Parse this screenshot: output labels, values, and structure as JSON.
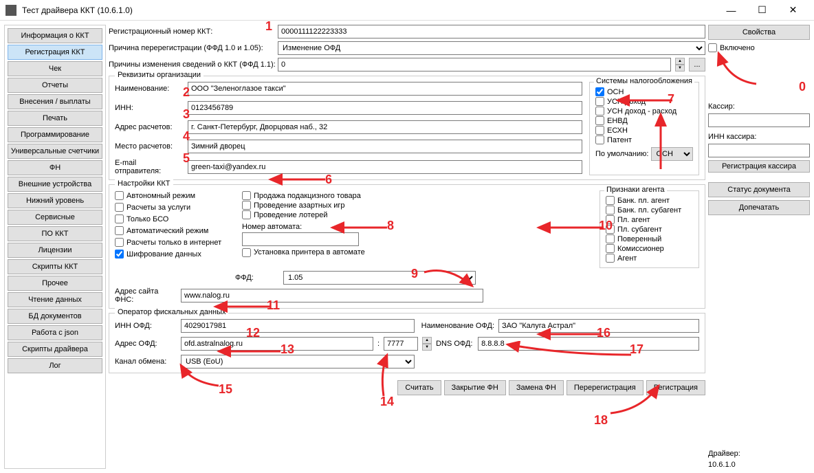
{
  "titlebar": {
    "title": "Тест драйвера ККТ (10.6.1.0)"
  },
  "sidebar_left": [
    "Информация о ККТ",
    "Регистрация ККТ",
    "Чек",
    "Отчеты",
    "Внесения / выплаты",
    "Печать",
    "Программирование",
    "Универсальные счетчики",
    "ФН",
    "Внешние устройства",
    "Нижний уровень",
    "Сервисные",
    "ПО ККТ",
    "Лицензии",
    "Скрипты ККТ",
    "Прочее",
    "Чтение данных",
    "БД документов",
    "Работа с json",
    "Скрипты драйвера",
    "Лог"
  ],
  "sidebar_active_index": 1,
  "top": {
    "reg_num_label": "Регистрационный номер ККТ:",
    "reg_num_value": "0000111122223333",
    "rereg_reason_label": "Причина перерегистрации (ФФД 1.0 и 1.05):",
    "rereg_reason_value": "Изменение ОФД",
    "change_reasons_label": "Причины изменения сведений о ККТ (ФФД 1.1):",
    "change_reasons_value": "0"
  },
  "org": {
    "legend": "Реквизиты организации",
    "name_label": "Наименование:",
    "name_value": "ООО \"Зеленоглазое такси\"",
    "inn_label": "ИНН:",
    "inn_value": "0123456789",
    "addr_label": "Адрес расчетов:",
    "addr_value": "г. Санкт-Петербург, Дворцовая наб., 32",
    "place_label": "Место расчетов:",
    "place_value": "Зимний дворец",
    "email_label": "E-mail отправителя:",
    "email_value": "green-taxi@yandex.ru"
  },
  "tax": {
    "legend": "Системы налогообложения",
    "items": [
      {
        "label": "ОСН",
        "checked": true
      },
      {
        "label": "УСН доход",
        "checked": false
      },
      {
        "label": "УСН доход - расход",
        "checked": false
      },
      {
        "label": "ЕНВД",
        "checked": false
      },
      {
        "label": "ЕСХН",
        "checked": false
      },
      {
        "label": "Патент",
        "checked": false
      }
    ],
    "default_label": "По умолчанию:",
    "default_value": "ОСН"
  },
  "kkt": {
    "legend": "Настройки ККТ",
    "col1": [
      {
        "label": "Автономный режим",
        "checked": false
      },
      {
        "label": "Расчеты за услуги",
        "checked": false
      },
      {
        "label": "Только БСО",
        "checked": false
      },
      {
        "label": "Автоматический режим",
        "checked": false
      },
      {
        "label": "Расчеты только в интернет",
        "checked": false
      },
      {
        "label": "Шифрование данных",
        "checked": true
      }
    ],
    "col2": [
      {
        "label": "Продажа подакцизного товара",
        "checked": false
      },
      {
        "label": "Проведение азартных игр",
        "checked": false
      },
      {
        "label": "Проведение лотерей",
        "checked": false
      }
    ],
    "automat_label": "Номер автомата:",
    "automat_value": "",
    "printer_label": "Установка принтера в автомате",
    "ffd_label": "ФФД:",
    "ffd_value": "1.05",
    "fns_label": "Адрес сайта ФНС:",
    "fns_value": "www.nalog.ru"
  },
  "agent": {
    "legend": "Признаки агента",
    "items": [
      {
        "label": "Банк. пл. агент",
        "checked": false
      },
      {
        "label": "Банк. пл. субагент",
        "checked": false
      },
      {
        "label": "Пл. агент",
        "checked": false
      },
      {
        "label": "Пл. субагент",
        "checked": false
      },
      {
        "label": "Поверенный",
        "checked": false
      },
      {
        "label": "Комиссионер",
        "checked": false
      },
      {
        "label": "Агент",
        "checked": false
      }
    ]
  },
  "ofd": {
    "legend": "Оператор фискальных данных",
    "inn_label": "ИНН ОФД:",
    "inn_value": "4029017981",
    "name_label": "Наименование ОФД:",
    "name_value": "ЗАО \"Калуга Астрал\"",
    "addr_label": "Адрес ОФД:",
    "addr_value": "ofd.astralnalog.ru",
    "port_value": "7777",
    "dns_label": "DNS ОФД:",
    "dns_value": "8.8.8.8",
    "channel_label": "Канал обмена:",
    "channel_value": "USB (EoU)"
  },
  "actions": {
    "read": "Считать",
    "close_fn": "Закрытие ФН",
    "replace_fn": "Замена ФН",
    "rereg": "Перерегистрация",
    "reg": "Регистрация"
  },
  "right": {
    "props": "Свойства",
    "enabled": "Включено",
    "cashier_label": "Кассир:",
    "cashier_value": "",
    "cashier_inn_label": "ИНН кассира:",
    "cashier_inn_value": "",
    "reg_cashier": "Регистрация кассира",
    "doc_status": "Статус документа",
    "doprint": "Допечатать",
    "driver_label": "Драйвер:",
    "driver_ver": "10.6.1.0"
  },
  "annotations": [
    "0",
    "1",
    "2",
    "3",
    "4",
    "5",
    "6",
    "7",
    "8",
    "9",
    "10",
    "11",
    "12",
    "13",
    "14",
    "15",
    "16",
    "17",
    "18"
  ]
}
